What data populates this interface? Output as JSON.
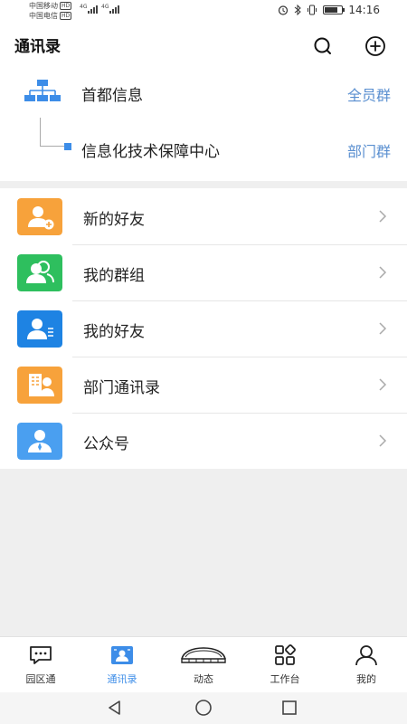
{
  "status_bar": {
    "carrier_1": "中国移动",
    "carrier_2": "中国电信",
    "hd_badge": "HD",
    "network_1": "4G",
    "network_2": "4G",
    "time": "14:16",
    "battery_level": 0.75,
    "icons": [
      "alarm-icon",
      "bluetooth-icon",
      "vibrate-icon",
      "battery-icon"
    ]
  },
  "header": {
    "title": "通讯录",
    "icons": [
      "search-icon",
      "add-circle-icon"
    ]
  },
  "org": {
    "root_name": "首都信息",
    "root_tag": "全员群",
    "child_name": "信息化技术保障中心",
    "child_tag": "部门群",
    "tag_color": "#5a8fd0"
  },
  "list": {
    "items": [
      {
        "label": "新的好友",
        "icon": "add-friend-icon",
        "color": "#f7a23b"
      },
      {
        "label": "我的群组",
        "icon": "group-icon",
        "color": "#2ebf5e"
      },
      {
        "label": "我的好友",
        "icon": "friend-list-icon",
        "color": "#1e83e3"
      },
      {
        "label": "部门通讯录",
        "icon": "department-directory-icon",
        "color": "#f7a23b"
      },
      {
        "label": "公众号",
        "icon": "official-account-icon",
        "color": "#4a9ff0"
      }
    ]
  },
  "tabbar": {
    "active_color": "#3d8de8",
    "tabs": [
      {
        "label": "园区通",
        "icon": "chat-icon",
        "active": false
      },
      {
        "label": "通讯录",
        "icon": "contacts-icon",
        "active": true
      },
      {
        "label": "动态",
        "icon": "stadium-icon",
        "active": false
      },
      {
        "label": "工作台",
        "icon": "apps-grid-icon",
        "active": false
      },
      {
        "label": "我的",
        "icon": "profile-icon",
        "active": false
      }
    ]
  },
  "system_nav": {
    "icons": [
      "back-icon",
      "home-icon",
      "recents-icon"
    ]
  }
}
